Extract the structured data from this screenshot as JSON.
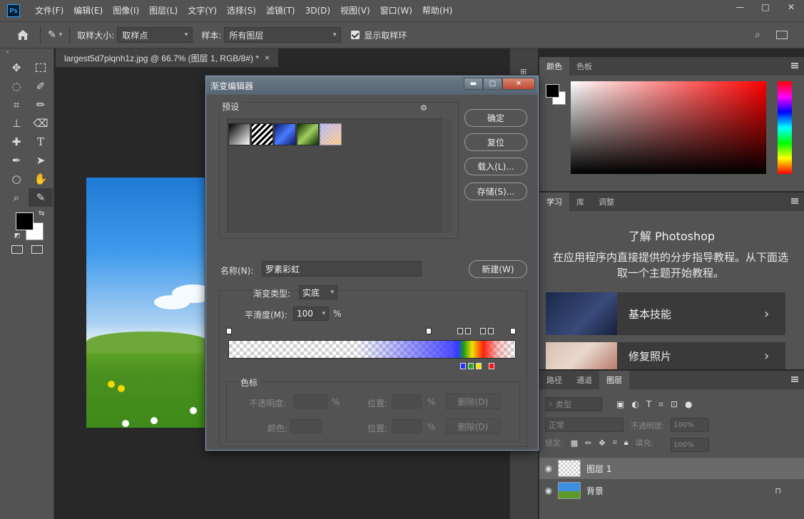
{
  "app": {
    "logo": "Ps",
    "menu": [
      "文件(F)",
      "编辑(E)",
      "图像(I)",
      "图层(L)",
      "文字(Y)",
      "选择(S)",
      "滤镜(T)",
      "3D(D)",
      "视图(V)",
      "窗口(W)",
      "帮助(H)"
    ],
    "window_controls": {
      "minimize": "—",
      "maximize": "□",
      "close": "✕"
    }
  },
  "options": {
    "sample_size_label": "取样大小:",
    "sample_size_value": "取样点",
    "sample_label": "样本:",
    "sample_value": "所有图层",
    "show_ring_label": "显示取样环",
    "show_ring_checked": true
  },
  "document": {
    "tab_title": "largest5d7plqnh1z.jpg @ 66.7% (图层 1, RGB/8#) *",
    "tab_close": "×"
  },
  "panels": {
    "color_tabs": [
      "颜色",
      "色板"
    ],
    "learn_tabs": [
      "学习",
      "库",
      "调整"
    ],
    "learn_title": "了解 Photoshop",
    "learn_desc": "在应用程序内直接提供的分步指导教程。从下面选取一个主题开始教程。",
    "learn_cards": [
      {
        "label": "基本技能"
      },
      {
        "label": "修复照片"
      }
    ],
    "layers_tabs": [
      "路径",
      "通道",
      "图层"
    ],
    "layers_filter": "类型",
    "blend_mode": "正常",
    "opacity_label": "不透明度:",
    "opacity_value": "100%",
    "lock_label": "锁定:",
    "fill_label": "填充:",
    "fill_value": "100%",
    "layers": [
      {
        "name": "图层 1",
        "selected": true
      },
      {
        "name": "背景",
        "selected": false,
        "locked": true
      }
    ]
  },
  "dialog": {
    "title": "渐变编辑器",
    "presets_label": "预设",
    "buttons": {
      "ok": "确定",
      "reset": "复位",
      "load": "载入(L)...",
      "save": "存储(S)...",
      "new": "新建(W)"
    },
    "name_label": "名称(N):",
    "name_value": "罗素彩虹",
    "gradient_type_label": "渐变类型:",
    "gradient_type_value": "实底",
    "smoothness_label": "平滑度(M):",
    "smoothness_value": "100",
    "percent": "%",
    "stops_label": "色标",
    "opacity_label": "不透明度:",
    "position_label": "位置:",
    "delete_label": "删除(D)",
    "color_label": "颜色:"
  }
}
